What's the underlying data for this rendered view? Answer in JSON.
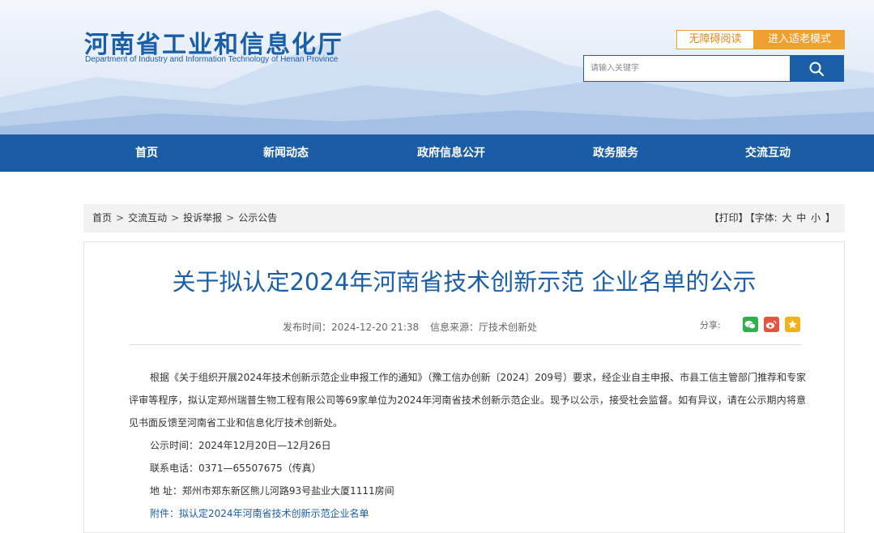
{
  "header": {
    "logo_cn": "河南省工业和信息化厅",
    "logo_en": "Department of Industry and Information Technology of Henan Province",
    "accessible_label": "无障碍阅读",
    "elder_mode_label": "进入适老模式",
    "search_placeholder": "请输入关键字"
  },
  "nav": {
    "items": [
      "首页",
      "新闻动态",
      "政府信息公开",
      "政务服务",
      "交流互动"
    ]
  },
  "breadcrumb": {
    "items": [
      "首页",
      "交流互动",
      "投诉举报",
      "公示公告"
    ],
    "separator": ">",
    "print_label": "【打印】",
    "font_label": "【字体:",
    "font_large": "大",
    "font_medium": "中",
    "font_small": "小",
    "font_close": "】"
  },
  "article": {
    "title": "关于拟认定2024年河南省技术创新示范 企业名单的公示",
    "publish_time": "发布时间：2024-12-20 21:38",
    "source": "信息来源：厅技术创新处",
    "share_label": "分享:",
    "paragraph": "根据《关于组织开展2024年技术创新示范企业申报工作的通知》（豫工信办创新〔2024〕209号）要求，经企业自主申报、市县工信主管部门推荐和专家评审等程序，拟认定郑州瑞普生物工程有限公司等69家单位为2024年河南省技术创新示范企业。现予以公示，接受社会监督。如有异议，请在公示期内将意见书面反馈至河南省工业和信息化厅技术创新处。",
    "notice_period": "公示时间：2024年12月20日—12月26日",
    "phone": "联系电话：0371—65507675（传真）",
    "address": "地 址：郑州市郑东新区熊儿河路93号盐业大厦1111房间",
    "attachment": "附件：拟认定2024年河南省技术创新示范企业名单"
  },
  "colors": {
    "brand_blue": "#1a5da6",
    "accent_orange": "#f0a030",
    "wechat_green": "#2fb14a",
    "weibo_red": "#e8533e",
    "favorite_yellow": "#f3b21a"
  }
}
